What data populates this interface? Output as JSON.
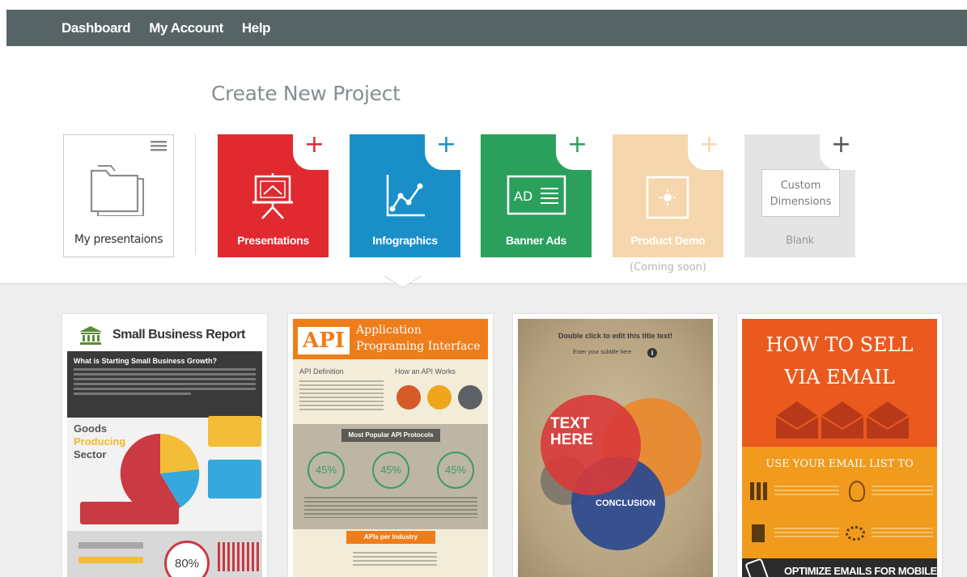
{
  "nav": {
    "items": [
      "Dashboard",
      "My Account",
      "Help"
    ]
  },
  "page_title": "Create New Project",
  "tiles": {
    "my_presentations": "My presentaions",
    "presentations": "Presentations",
    "infographics": "Infographics",
    "banner_ads": "Banner Ads",
    "banner_ads_icon_text": "AD",
    "product_demo": "Product Demo",
    "product_demo_note": "(Coming soon)",
    "blank": "Blank",
    "blank_box_line1": "Custom",
    "blank_box_line2": "Dimensions",
    "plus": "+"
  },
  "colors": {
    "presentations": "#e02a2f",
    "infographics": "#1a8fc7",
    "banner_ads": "#2aa05c",
    "product_demo": "#f6d7ad",
    "blank": "#e4e4e4"
  },
  "templates": {
    "t1": {
      "title": "Small Business Report",
      "question": "What is Starting Small Business Growth?",
      "sector_line1": "Goods",
      "sector_line2": "Producing",
      "sector_line3": "Sector",
      "percent": "80%"
    },
    "t2": {
      "badge": "API",
      "title_line1": "Application",
      "title_line2": "Programing Interface",
      "col1": "API Definition",
      "col2": "How an API Works",
      "band1": "Most Popular API Protocols",
      "pct1": "45%",
      "pct2": "45%",
      "pct3": "45%",
      "band2": "APIs per Industry"
    },
    "t3": {
      "title": "Double click to edit this title text!",
      "subtitle": "Enter your subtitle here",
      "big_line1": "TEXT",
      "big_line2": "HERE",
      "conclusion": "CONCLUSION"
    },
    "t4": {
      "title_line1": "HOW TO SELL",
      "title_line2": "VIA EMAIL",
      "band": "USE YOUR EMAIL LIST TO",
      "footer": "OPTIMIZE EMAILS FOR MOBILE"
    }
  }
}
